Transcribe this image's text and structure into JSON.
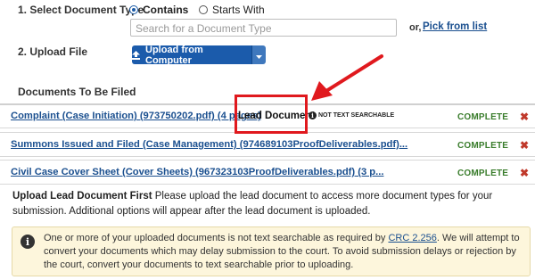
{
  "step1": {
    "label": "1. Select Document Type",
    "options": [
      {
        "label": "Contains",
        "checked": true
      },
      {
        "label": "Starts With",
        "checked": false
      }
    ],
    "search_placeholder": "Search for a Document Type",
    "or_text": "or,",
    "pick_link": "Pick from list"
  },
  "step2": {
    "label": "2. Upload File",
    "upload_button": "Upload from Computer",
    "upload_icon": "upload-icon",
    "caret_icon": "caret-down-icon"
  },
  "documents": {
    "heading": "Documents To Be Filed",
    "items": [
      {
        "name": "Complaint (Case Initiation) (973750202.pdf) (4 pages)",
        "lead_badge": "Lead Document",
        "warning": "NOT TEXT SEARCHABLE",
        "status": "COMPLETE"
      },
      {
        "name": "Summons Issued and Filed (Case Management) (974689103ProofDeliverables.pdf)...",
        "status": "COMPLETE"
      },
      {
        "name": "Civil Case Cover Sheet (Cover Sheets) (967323103ProofDeliverables.pdf) (3 p...",
        "status": "COMPLETE"
      }
    ]
  },
  "lead_note": {
    "title": "Upload Lead Document First",
    "text": "Please upload the lead document to access more document types for your submission. Additional options will appear after the lead document is uploaded."
  },
  "notice": {
    "icon": "info-icon",
    "before_link": "One or more of your uploaded documents is not text searchable as required by",
    "link": "CRC 2.256",
    "after_link": ". We will attempt to convert your documents which may delay submission to the court. To avoid submission delays or rejection by the court, convert your documents to text searchable prior to uploading."
  },
  "colors": {
    "link_blue": "#1a4f8f",
    "button_blue": "#1b5bab",
    "complete_green": "#3a7d2c",
    "annotation_red": "#e0191e",
    "notice_bg": "#fdf6dc"
  }
}
